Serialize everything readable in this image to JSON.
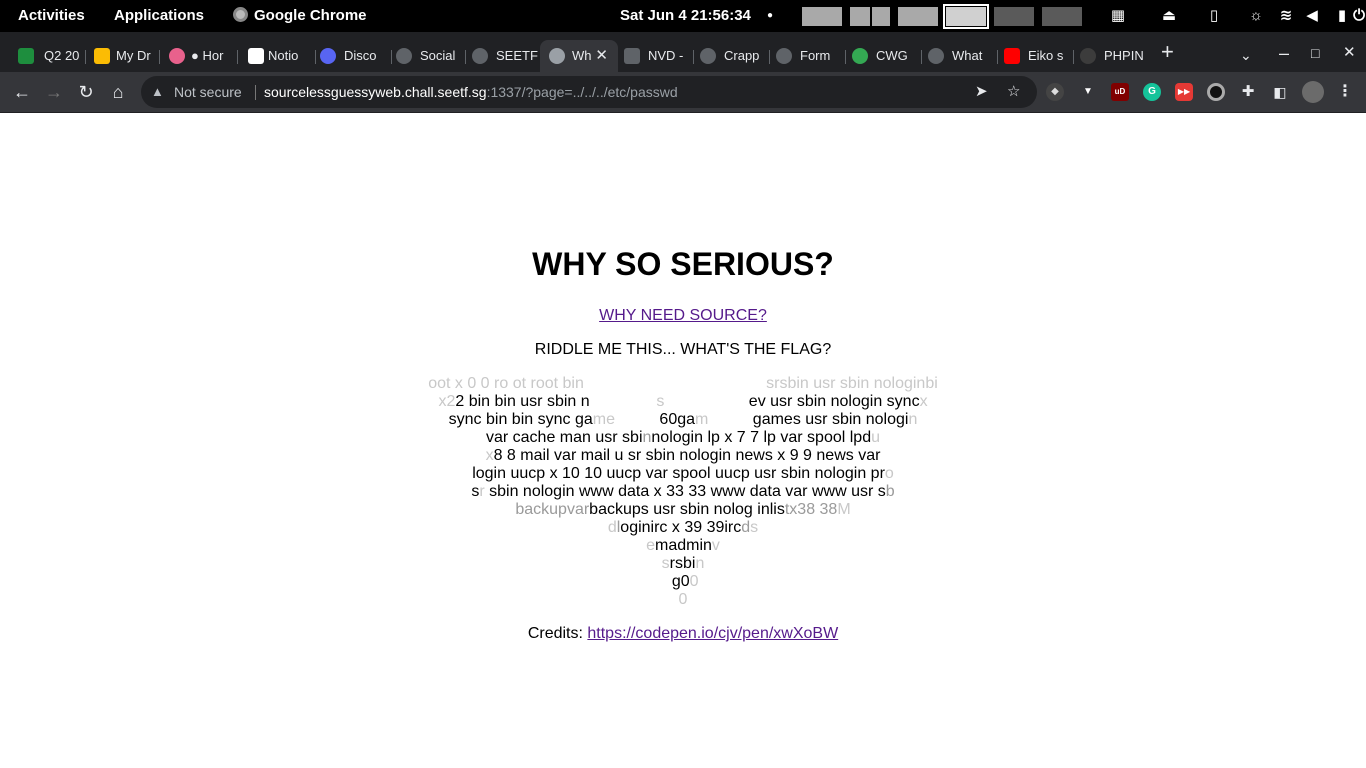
{
  "topbar": {
    "activities": "Activities",
    "applications": "Applications",
    "app_name": "Google Chrome",
    "clock": "Sat Jun 4  21:56:34",
    "dot": "●"
  },
  "tabs": [
    {
      "label": "Q2 20",
      "favicon_color": "#1e8e3e"
    },
    {
      "label": "My Dr",
      "favicon_color": "#fbbc04"
    },
    {
      "label": "● Hor",
      "favicon_color": "#e8618c"
    },
    {
      "label": "Notio",
      "favicon_color": "#ffffff"
    },
    {
      "label": "Disco",
      "favicon_color": "#5865f2"
    },
    {
      "label": "Social",
      "favicon_color": "#9aa0a6"
    },
    {
      "label": "SEETF",
      "favicon_color": "#9aa0a6"
    },
    {
      "label": "Wh",
      "favicon_color": "#9aa0a6"
    },
    {
      "label": "NVD -",
      "favicon_color": "#9aa0a6"
    },
    {
      "label": "Crapp",
      "favicon_color": "#9aa0a6"
    },
    {
      "label": "Form",
      "favicon_color": "#9aa0a6"
    },
    {
      "label": "CWG",
      "favicon_color": "#34a853"
    },
    {
      "label": "What",
      "favicon_color": "#9aa0a6"
    },
    {
      "label": "Eiko s",
      "favicon_color": "#ff0000"
    },
    {
      "label": "PHPIN",
      "favicon_color": "#9aa0a6"
    }
  ],
  "toolbar": {
    "not_secure": "Not secure",
    "url_host": "sourcelessguessyweb.chall.seetf.sg",
    "url_rest": ":1337/?page=../../../etc/passwd"
  },
  "page": {
    "title": "WHY SO SERIOUS?",
    "source_link": "WHY NEED SOURCE?",
    "riddle": "RIDDLE ME THIS... WHAT'S THE FLAG?",
    "credits_label": "Credits: ",
    "credits_link": "https://codepen.io/cjv/pen/xwXoBW"
  },
  "smiley_rows": [
    [
      [
        "f",
        "oot x 0 0 ro ot root bin"
      ],
      [
        "n",
        "                                         "
      ],
      [
        "f",
        "srsbin usr sbin nologinbi"
      ]
    ],
    [
      [
        "f",
        "x2"
      ],
      [
        "n",
        "2 bin bin usr sbin n"
      ],
      [
        "f",
        "               s"
      ],
      [
        "n",
        "                   ev usr sbin nologin sync"
      ],
      [
        "f",
        "x"
      ]
    ],
    [
      [
        "n",
        "sync bin bin sync ga"
      ],
      [
        "f",
        "me"
      ],
      [
        "n",
        "          60ga"
      ],
      [
        "f",
        "m"
      ],
      [
        "n",
        "          games usr sbin nologi"
      ],
      [
        "f",
        "n"
      ]
    ],
    [
      [
        "n",
        "var cache man usr sbi"
      ],
      [
        "m",
        "n"
      ],
      [
        "n",
        "nologin lp x 7 7 lp var spool lpd"
      ],
      [
        "f",
        "u"
      ]
    ],
    [
      [
        "f",
        "x"
      ],
      [
        "n",
        "8 8 mail var mail u sr sbin nologin news x 9 9 news var"
      ]
    ],
    [
      [
        "n",
        "login uucp x 10 10 uucp var spool uucp usr sbin nologin pr"
      ],
      [
        "f",
        "o"
      ]
    ],
    [
      [
        "n",
        "s"
      ],
      [
        "f",
        "r"
      ],
      [
        "n",
        " sbin nologin www data x 33 33 www data var www usr s"
      ],
      [
        "m",
        "b"
      ]
    ],
    [
      [
        "m",
        "backupvar"
      ],
      [
        "n",
        "backups usr sbin nolog inlis"
      ],
      [
        "m",
        "tx38 38"
      ],
      [
        "f",
        "M"
      ]
    ],
    [
      [
        "f",
        "d"
      ],
      [
        "m",
        "l"
      ],
      [
        "n",
        "oginirc x 39 39irc"
      ],
      [
        "m",
        "d"
      ],
      [
        "f",
        "s"
      ]
    ],
    [
      [
        "f",
        "e"
      ],
      [
        "n",
        "madmin"
      ],
      [
        "f",
        "v"
      ]
    ],
    [
      [
        "f",
        "s"
      ],
      [
        "n",
        "rsbi"
      ],
      [
        "f",
        "n"
      ]
    ],
    [
      [
        "n",
        " g0"
      ],
      [
        "f",
        "0"
      ]
    ],
    [
      [
        "f",
        "0"
      ]
    ]
  ]
}
